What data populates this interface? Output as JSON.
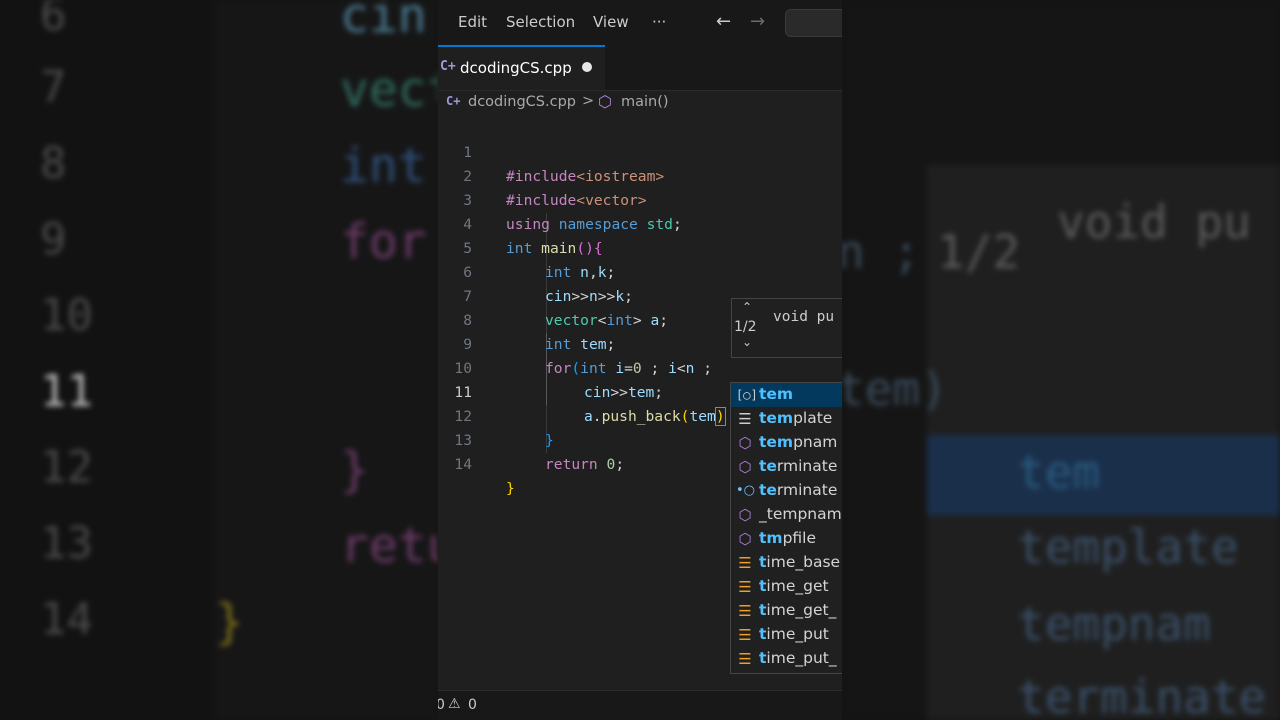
{
  "menubar": {
    "items": [
      "Edit",
      "Selection",
      "View",
      "···"
    ],
    "back_icon": "arrow-left-icon",
    "forward_icon": "arrow-right-icon"
  },
  "tab": {
    "filename": "dcodingCS.cpp",
    "icon": "cpp-file-icon",
    "modified": true
  },
  "breadcrumb": {
    "file": "dcodingCS.cpp",
    "separator": ">",
    "symbol": "main()"
  },
  "editor": {
    "current_line": 11,
    "lines": [
      {
        "num": "1"
      },
      {
        "num": "2"
      },
      {
        "num": "3"
      },
      {
        "num": "4"
      },
      {
        "num": "5"
      },
      {
        "num": "6"
      },
      {
        "num": "7"
      },
      {
        "num": "8"
      },
      {
        "num": "9"
      },
      {
        "num": "10"
      },
      {
        "num": "11"
      },
      {
        "num": "12"
      },
      {
        "num": "13"
      },
      {
        "num": "14"
      }
    ],
    "code": {
      "l1": {
        "a": "#include",
        "b": "<iostream>"
      },
      "l2": {
        "a": "#include",
        "b": "<vector>"
      },
      "l3": {
        "a": "using",
        "b": " ",
        "c": "namespace",
        "d": " ",
        "e": "std",
        "f": ";"
      },
      "l4": {
        "a": "int",
        "b": " ",
        "c": "main",
        "d": "()",
        "e": "{"
      },
      "l5": {
        "a": "int",
        "b": " ",
        "c": "n",
        "d": ",",
        "e": "k",
        "f": ";"
      },
      "l6": {
        "a": "cin",
        "b": ">>",
        "c": "n",
        "d": ">>",
        "e": "k",
        "f": ";"
      },
      "l7": {
        "a": "vector",
        "b": "<",
        "c": "int",
        "d": "> ",
        "e": "a",
        "f": ";"
      },
      "l8": {
        "a": "int",
        "b": " ",
        "c": "tem",
        "d": ";"
      },
      "l9": {
        "a": "for",
        "b": "(",
        "c": "int",
        "d": " ",
        "e": "i",
        "f": "=",
        "g": "0",
        "h": " ; ",
        "i": "i",
        "j": "<",
        "k": "n",
        "l": " ;"
      },
      "l10": {
        "a": "cin",
        "b": ">>",
        "c": "tem",
        "d": ";"
      },
      "l11": {
        "a": "a",
        "b": ".",
        "c": "push_back",
        "d": "(",
        "e": "tem",
        "f": ")"
      },
      "l12": {
        "a": "}"
      },
      "l13": {
        "a": "return",
        "b": " ",
        "c": "0",
        "d": ";"
      },
      "l14": {
        "a": "}"
      }
    }
  },
  "signature_help": {
    "up_icon": "chevron-up-icon",
    "count": "1/2",
    "down_icon": "chevron-down-icon",
    "signature": "void pu"
  },
  "suggestions": [
    {
      "icon": "variable-icon",
      "match": "tem",
      "rest": "",
      "selected": true
    },
    {
      "icon": "snippet-icon",
      "match": "tem",
      "rest": "plate",
      "selected": false
    },
    {
      "icon": "function-icon",
      "match": "tem",
      "rest": "pnam",
      "selected": false
    },
    {
      "icon": "function-icon",
      "match": "te",
      "rest": "rminate",
      "selected": false
    },
    {
      "icon": "interface-icon",
      "match": "te",
      "rest": "rminate",
      "selected": false
    },
    {
      "icon": "function-icon",
      "match": "",
      "rest": "_tempnam",
      "selected": false
    },
    {
      "icon": "function-icon",
      "match": "tm",
      "rest": "pfile",
      "selected": false
    },
    {
      "icon": "class-icon",
      "match": "t",
      "rest": "ime_base",
      "selected": false
    },
    {
      "icon": "class-icon",
      "match": "t",
      "rest": "ime_get",
      "selected": false
    },
    {
      "icon": "class-icon",
      "match": "t",
      "rest": "ime_get_",
      "selected": false
    },
    {
      "icon": "class-icon",
      "match": "t",
      "rest": "ime_put",
      "selected": false
    },
    {
      "icon": "class-icon",
      "match": "t",
      "rest": "ime_put_",
      "selected": false
    }
  ],
  "statusbar": {
    "errors": "0",
    "warnings": "0",
    "warning_icon": "warning-icon"
  },
  "backdrop": {
    "left_lines": [
      "6",
      "7",
      "8",
      "9",
      "10",
      "11",
      "12",
      "13",
      "14"
    ],
    "left_code": [
      "cin",
      "vect",
      "int",
      "for",
      "",
      "",
      "}",
      "retu",
      "}"
    ],
    "right_count": "1/2",
    "right_sig": "void pu",
    "right_code": [
      "n ;",
      "tem)"
    ],
    "right_suggest": [
      "tem",
      "template",
      "tempnam",
      "terminate"
    ]
  },
  "colors": {
    "accent": "#0078d4",
    "editor_bg": "#1f1f1f",
    "match_highlight": "#4fc1ff",
    "selected_suggestion": "#04395e"
  }
}
